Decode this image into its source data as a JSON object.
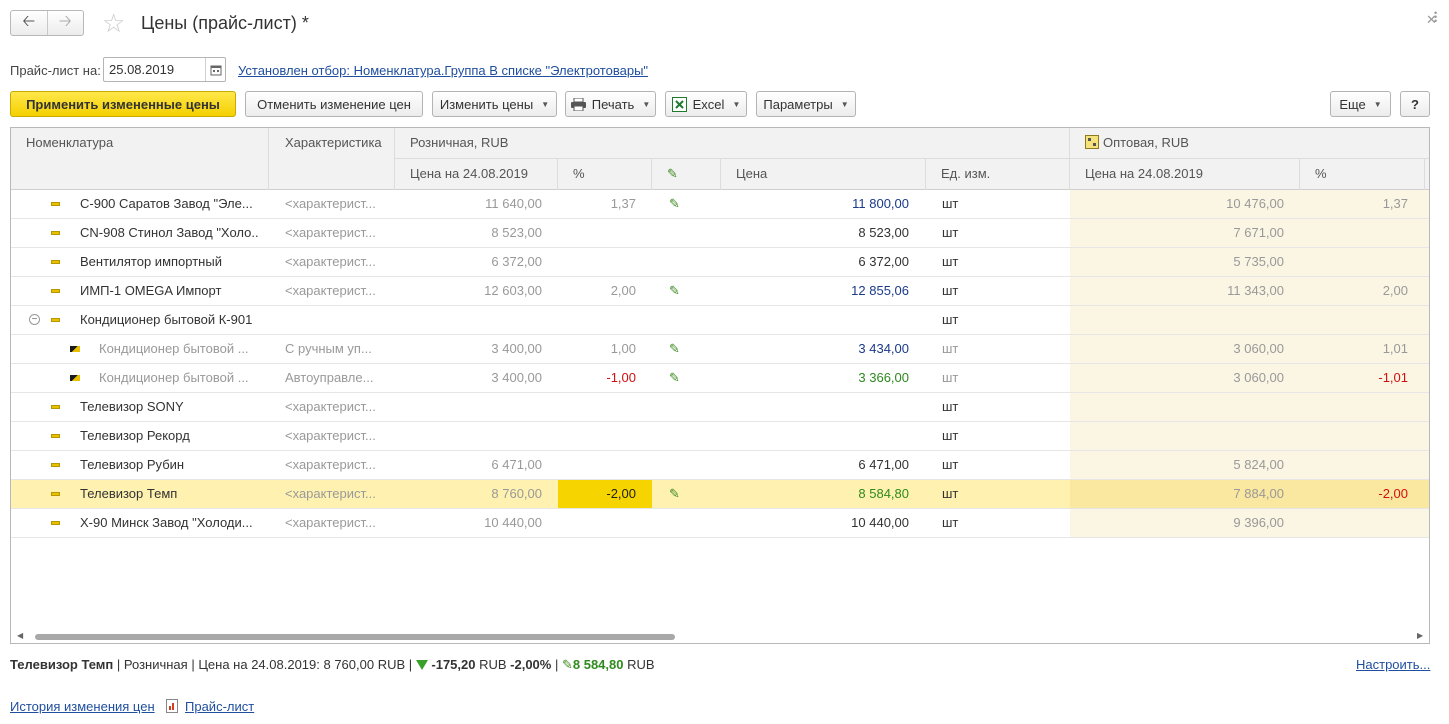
{
  "window": {
    "title": "Цены (прайс-лист) *",
    "back_icon": "arrow-left-icon",
    "forward_icon": "arrow-right-icon"
  },
  "filter": {
    "date_label": "Прайс-лист на:",
    "date_value": "25.08.2019",
    "filter_link": "Установлен отбор: Номенклатура.Группа В списке \"Электротовары\""
  },
  "toolbar": {
    "apply": "Применить измененные цены",
    "cancel": "Отменить изменение цен",
    "change_prices": "Изменить цены",
    "print": "Печать",
    "excel": "Excel",
    "params": "Параметры",
    "more": "Еще",
    "help": "?"
  },
  "table": {
    "headers": {
      "nomenclature": "Номенклатура",
      "characteristic": "Характеристика",
      "retail_group": "Розничная, RUB",
      "wholesale_group": "Оптовая, RUB",
      "old_price": "Цена на 24.08.2019",
      "pct": "%",
      "price": "Цена",
      "unit": "Ед. изм.",
      "w_old_price": "Цена на 24.08.2019",
      "w_pct": "%"
    },
    "rows": [
      {
        "name": "С-900 Саратов Завод \"Эле...",
        "char": "<характерист...",
        "old": "11 640,00",
        "pct": "1,37",
        "edit": true,
        "price": "11 800,00",
        "price_color": "blue",
        "unit": "шт",
        "w_old": "10 476,00",
        "w_pct": "1,37"
      },
      {
        "name": "CN-908 Стинол Завод \"Холо...",
        "char": "<характерист...",
        "old": "8 523,00",
        "pct": "",
        "edit": false,
        "price": "8 523,00",
        "price_color": "",
        "unit": "шт",
        "w_old": "7 671,00",
        "w_pct": ""
      },
      {
        "name": "Вентилятор импортный",
        "char": "<характерист...",
        "old": "6 372,00",
        "pct": "",
        "edit": false,
        "price": "6 372,00",
        "price_color": "",
        "unit": "шт",
        "w_old": "5 735,00",
        "w_pct": ""
      },
      {
        "name": "ИМП-1 OMEGA Импорт",
        "char": "<характерист...",
        "old": "12 603,00",
        "pct": "2,00",
        "edit": true,
        "price": "12 855,06",
        "price_color": "blue",
        "unit": "шт",
        "w_old": "11 343,00",
        "w_pct": "2,00"
      },
      {
        "name": "Кондиционер бытовой К-901",
        "char": "",
        "old": "",
        "pct": "",
        "edit": false,
        "price": "",
        "price_color": "",
        "unit": "шт",
        "w_old": "",
        "w_pct": "",
        "group": true
      },
      {
        "name": "Кондиционер бытовой ...",
        "char": "С ручным уп...",
        "old": "3 400,00",
        "pct": "1,00",
        "edit": true,
        "price": "3 434,00",
        "price_color": "blue",
        "unit": "шт",
        "w_old": "3 060,00",
        "w_pct": "1,01",
        "sub": true
      },
      {
        "name": "Кондиционер бытовой ...",
        "char": "Автоуправле...",
        "old": "3 400,00",
        "pct": "-1,00",
        "pct_color": "red",
        "edit": true,
        "price": "3 366,00",
        "price_color": "green",
        "unit": "шт",
        "w_old": "3 060,00",
        "w_pct": "-1,01",
        "w_pct_color": "red",
        "sub": true
      },
      {
        "name": "Телевизор SONY",
        "char": "<характерист...",
        "old": "",
        "pct": "",
        "edit": false,
        "price": "",
        "price_color": "",
        "unit": "шт",
        "w_old": "",
        "w_pct": ""
      },
      {
        "name": "Телевизор Рекорд",
        "char": "<характерист...",
        "old": "",
        "pct": "",
        "edit": false,
        "price": "",
        "price_color": "",
        "unit": "шт",
        "w_old": "",
        "w_pct": ""
      },
      {
        "name": "Телевизор Рубин",
        "char": "<характерист...",
        "old": "6 471,00",
        "pct": "",
        "edit": false,
        "price": "6 471,00",
        "price_color": "",
        "unit": "шт",
        "w_old": "5 824,00",
        "w_pct": ""
      },
      {
        "name": "Телевизор Темп",
        "char": "<характерист...",
        "old": "8 760,00",
        "pct": "-2,00",
        "edit": true,
        "price": "8 584,80",
        "price_color": "green",
        "unit": "шт",
        "w_old": "7 884,00",
        "w_pct": "-2,00",
        "w_pct_color": "red",
        "selected": true
      },
      {
        "name": "Х-90 Минск Завод \"Холоди...",
        "char": "<характерист...",
        "old": "10 440,00",
        "pct": "",
        "edit": false,
        "price": "10 440,00",
        "price_color": "",
        "unit": "шт",
        "w_old": "9 396,00",
        "w_pct": ""
      }
    ]
  },
  "status": {
    "item": "Телевизор Темп",
    "sep1": " | ",
    "kind": "Розничная",
    "sep2": " | ",
    "price_text": "Цена на 24.08.2019: 8 760,00 RUB",
    "sep3": " | ",
    "delta": "-175,20",
    "delta_unit": " RUB ",
    "delta_pct": "-2,00%",
    "sep4": " | ",
    "new_price": "8 584,80",
    "new_unit": " RUB",
    "customize": "Настроить..."
  },
  "footer": {
    "history_link": "История изменения цен",
    "pricelist_link": "Прайс-лист"
  },
  "colors": {
    "primary_button": "#f4d000",
    "selected_row": "#fff2b0",
    "wholesale_bg": "#fbf6e3",
    "link": "#1f4e9e",
    "increase": "#1a3a8a",
    "decrease": "#2e8a1e",
    "negative": "#d01010"
  }
}
